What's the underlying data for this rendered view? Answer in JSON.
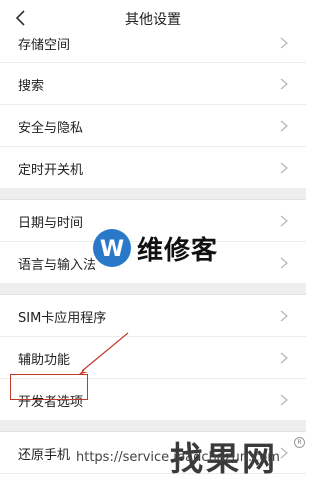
{
  "header": {
    "title": "其他设置"
  },
  "groups": [
    {
      "items": [
        {
          "label": "存储空间"
        },
        {
          "label": "搜索"
        },
        {
          "label": "安全与隐私"
        },
        {
          "label": "定时开关机"
        }
      ]
    },
    {
      "items": [
        {
          "label": "日期与时间"
        },
        {
          "label": "语言与输入法"
        }
      ]
    },
    {
      "items": [
        {
          "label": "SIM卡应用程序"
        },
        {
          "label": "辅助功能"
        },
        {
          "label": "开发者选项"
        }
      ]
    },
    {
      "items": [
        {
          "label": "还原手机"
        }
      ]
    }
  ],
  "watermarks": {
    "logo_text": "维修客",
    "bottom_text": "找果网",
    "url": "https://service.ipadchazun.com"
  },
  "colors": {
    "highlight": "#c0392b",
    "logo_blue": "#2a78c8"
  }
}
